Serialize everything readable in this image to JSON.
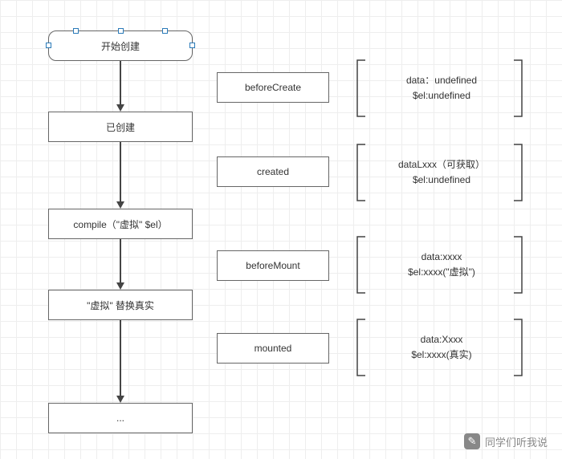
{
  "nodes": {
    "start": "开始创建",
    "created_label": "已创建",
    "compile": "compile（\"虚拟\" $el）",
    "replace": "\"虚拟\" 替换真实",
    "more": "..."
  },
  "hooks": {
    "beforeCreate": "beforeCreate",
    "created": "created",
    "beforeMount": "beforeMount",
    "mounted": "mounted"
  },
  "states": {
    "beforeCreate": {
      "l1": "data：undefined",
      "l2": "$el:undefined"
    },
    "created": {
      "l1": "dataLxxx（可获取）",
      "l2": "$el:undefined"
    },
    "beforeMount": {
      "l1": "data:xxxx",
      "l2": "$el:xxxx(\"虚拟\")"
    },
    "mounted": {
      "l1": "data:Xxxx",
      "l2": "$el:xxxx(真实)"
    }
  },
  "watermark": "同学们听我说"
}
